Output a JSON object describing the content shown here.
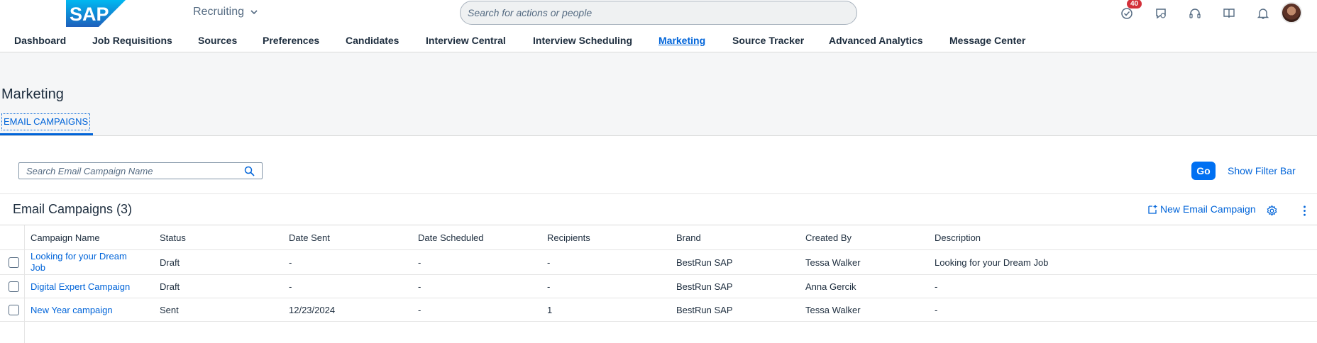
{
  "shell": {
    "logo_text": "SAP",
    "app_title": "Recruiting",
    "search_placeholder": "Search for actions or people",
    "notification_badge": "40",
    "icons": [
      "todo-check-icon",
      "chat-icon",
      "headset-icon",
      "book-icon",
      "bell-icon"
    ]
  },
  "nav": {
    "items": [
      {
        "label": "Dashboard"
      },
      {
        "label": "Job Requisitions"
      },
      {
        "label": "Sources"
      },
      {
        "label": "Preferences"
      },
      {
        "label": "Candidates"
      },
      {
        "label": "Interview Central"
      },
      {
        "label": "Interview Scheduling"
      },
      {
        "label": "Marketing"
      },
      {
        "label": "Source Tracker"
      },
      {
        "label": "Advanced Analytics"
      },
      {
        "label": "Message Center"
      }
    ],
    "active": "Marketing"
  },
  "page": {
    "title": "Marketing",
    "tab": "EMAIL CAMPAIGNS"
  },
  "filter": {
    "search_placeholder": "Search Email Campaign Name",
    "go_label": "Go",
    "show_filter_label": "Show Filter Bar"
  },
  "table": {
    "title": "Email Campaigns (3)",
    "new_label": "New Email Campaign",
    "columns": [
      "Campaign Name",
      "Status",
      "Date Sent",
      "Date Scheduled",
      "Recipients",
      "Brand",
      "Created By",
      "Description"
    ],
    "rows": [
      {
        "name_line1": "Looking for your Dream",
        "name_line2": "Job",
        "status": "Draft",
        "date_sent": "-",
        "date_scheduled": "-",
        "recipients": "-",
        "brand": "BestRun SAP",
        "created_by": "Tessa Walker",
        "description": "Looking for your Dream Job"
      },
      {
        "name_line1": "Digital Expert Campaign",
        "name_line2": "",
        "status": "Draft",
        "date_sent": "-",
        "date_scheduled": "-",
        "recipients": "-",
        "brand": "BestRun SAP",
        "created_by": "Anna Gercik",
        "description": "-"
      },
      {
        "name_line1": "New Year campaign",
        "name_line2": "",
        "status": "Sent",
        "date_sent": "12/23/2024",
        "date_scheduled": "-",
        "recipients": "1",
        "brand": "BestRun SAP",
        "created_by": "Tessa Walker",
        "description": "-"
      }
    ]
  },
  "colors": {
    "brand_blue": "#0070f2",
    "link_blue": "#0064d9",
    "badge_red": "#d3303a",
    "header_bg": "#f5f6f7"
  }
}
